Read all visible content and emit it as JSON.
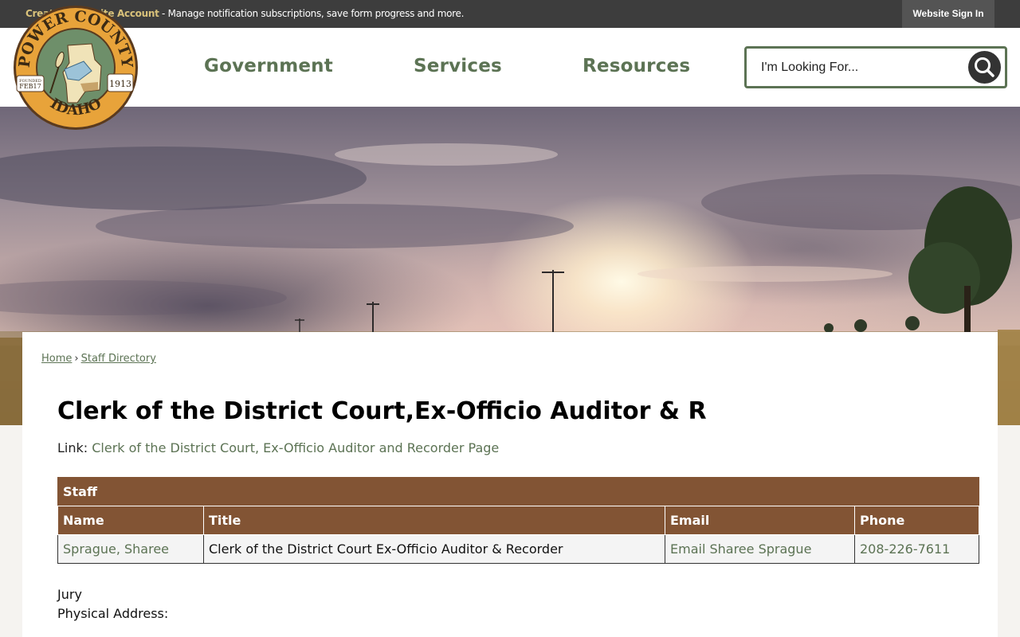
{
  "topbar": {
    "create_account_link": "Create a Website Account",
    "create_account_text": " - Manage notification subscriptions, save form progress and more.",
    "sign_in": "Website Sign In"
  },
  "logo": {
    "top_text": "POWER COUNTY",
    "bottom_text": "IDAHO",
    "founded_small": "FOUNDED",
    "founded_date": "FEB17",
    "year": "1913"
  },
  "nav": {
    "items": [
      {
        "label": "Government"
      },
      {
        "label": "Services"
      },
      {
        "label": "Resources"
      }
    ]
  },
  "search": {
    "placeholder": "I'm Looking For...",
    "icon": "search-icon"
  },
  "breadcrumb": {
    "home": "Home",
    "separator": "›",
    "current": "Staff Directory"
  },
  "page": {
    "title": "Clerk of the District Court,Ex-Officio Auditor & R",
    "link_label": "Link: ",
    "link_text": "Clerk of the District Court, Ex-Officio Auditor and Recorder Page"
  },
  "staff_table": {
    "caption": "Staff",
    "columns": [
      "Name",
      "Title",
      "Email",
      "Phone"
    ],
    "rows": [
      {
        "name": "Sprague, Sharee",
        "title": "Clerk of the District Court Ex-Officio Auditor & Recorder",
        "email": "Email Sharee Sprague",
        "phone": "208-226-7611"
      }
    ]
  },
  "after_table": {
    "line1": "Jury",
    "line2": "Physical Address:"
  },
  "colors": {
    "accent_green": "#5c7354",
    "table_brown": "#825434",
    "topbar_bg": "#3d3d3d",
    "account_link_gold": "#d9c27a"
  }
}
